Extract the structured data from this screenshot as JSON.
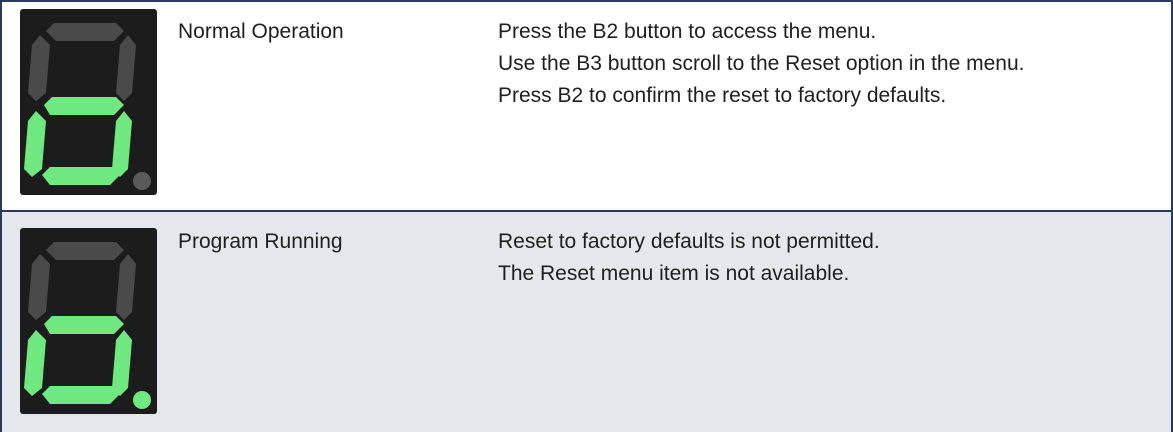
{
  "rows": [
    {
      "state": "Normal Operation",
      "lines": [
        "Press the B2 button to access the menu.",
        "Use the B3 button scroll to the Reset option in the menu.",
        "Press B2 to confirm the reset to factory defaults."
      ],
      "display_digit": "lower-zero",
      "decimal_point_lit": false
    },
    {
      "state": "Program Running",
      "lines": [
        "Reset to factory defaults is not permitted.",
        "The Reset menu item is not available."
      ],
      "display_digit": "lower-zero",
      "decimal_point_lit": true
    }
  ],
  "colors": {
    "segment_on": "#6fe87f",
    "segment_off": "#4a4a4a",
    "display_bg": "#1c1c1c",
    "border": "#2b3a58",
    "alt_row_bg": "#e6e7ea"
  }
}
